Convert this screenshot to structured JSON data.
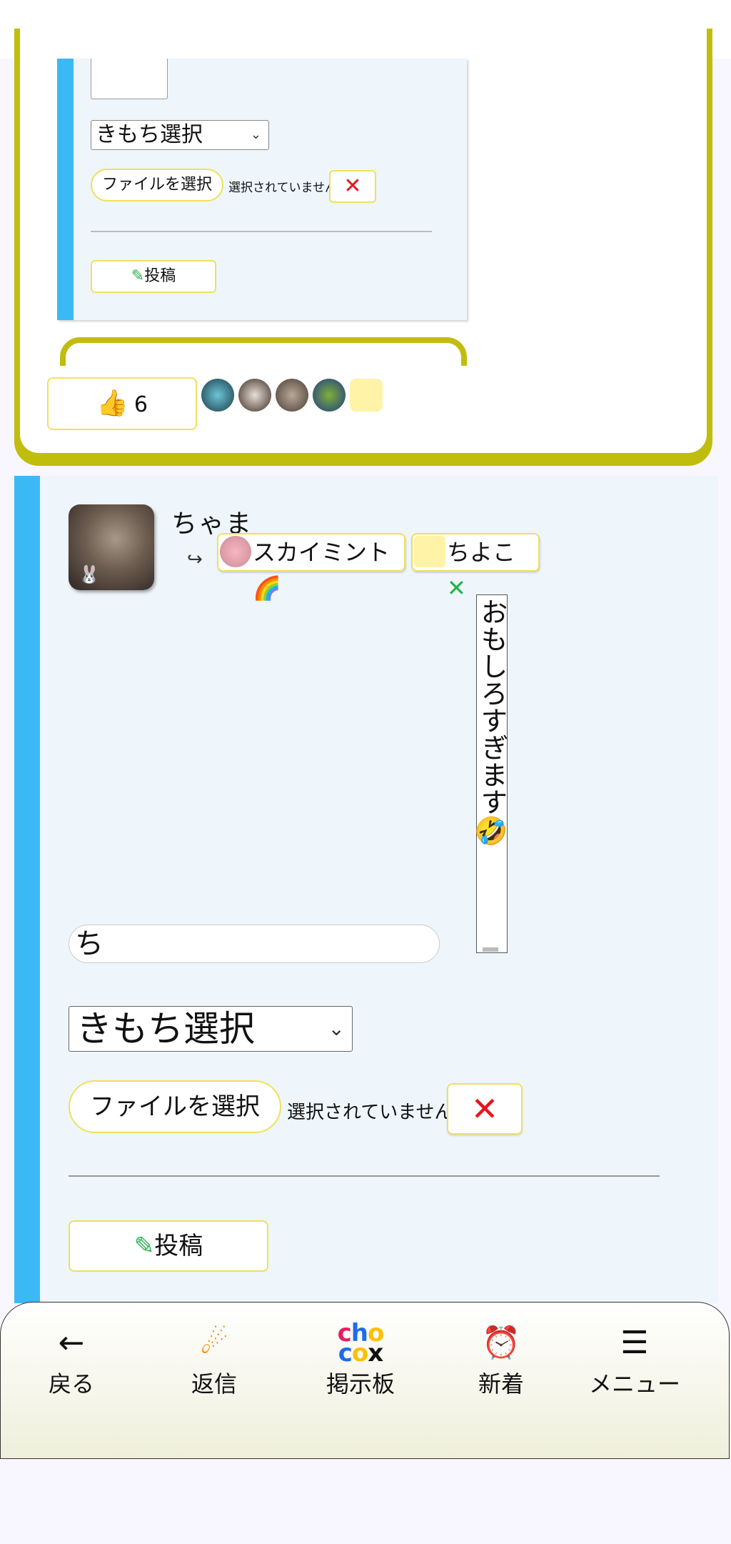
{
  "prev_post": {
    "feeling_select": "きもち選択",
    "file_button": "ファイルを選択",
    "file_status": "選択されていません",
    "clear_button": "✕",
    "post_button": "投稿",
    "like_count": "6"
  },
  "post": {
    "author": "ちゃま",
    "reply_arrow": "↪",
    "tags": [
      {
        "name": "スカイミント🌈"
      },
      {
        "name": "ちよこ"
      }
    ],
    "tag_remove": "✕",
    "comment": "おもしろすぎます🤣",
    "input_value": "ち",
    "feeling_select": "きもち選択",
    "file_button": "ファイルを選択",
    "file_status": "選択されていません",
    "clear_button": "✕",
    "post_button": "投稿"
  },
  "nav": {
    "back": "戻る",
    "reply": "返信",
    "board": "掲示板",
    "new": "新着",
    "menu": "メニュー"
  },
  "colors": {
    "accent_blue": "#3bb9f5",
    "card_border": "#c0bd0c",
    "button_border": "#f0e05a",
    "delete_red": "#e8151b"
  },
  "icons": {
    "back": "arrow-left-icon",
    "reply": "comet-icon",
    "board": "choco-logo-icon",
    "new": "alarm-clock-icon",
    "menu": "hamburger-icon",
    "like": "thumbs-up-icon",
    "post": "pencil-icon"
  }
}
